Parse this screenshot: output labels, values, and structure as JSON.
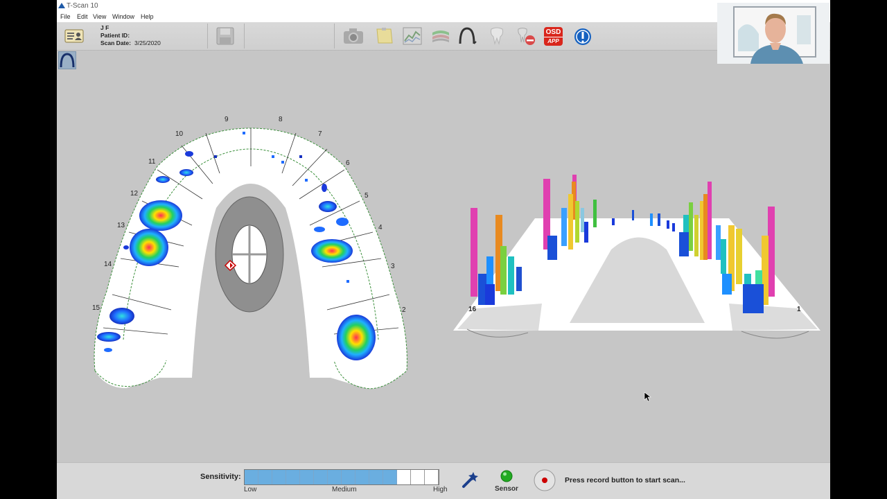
{
  "window": {
    "title": "T-Scan 10"
  },
  "menu": [
    "File",
    "Edit",
    "View",
    "Window",
    "Help"
  ],
  "patient": {
    "name": "J F",
    "id_label": "Patient ID:",
    "id_value": "",
    "scan_date_label": "Scan Date:",
    "scan_date": "3/25/2020"
  },
  "toolbar_icons": [
    "patient-card-icon",
    "save-icon",
    "camera-icon",
    "note-icon",
    "graph-icon",
    "tools-icon",
    "arch-icon",
    "tooth-icon",
    "tooth-remove-icon",
    "osd-app-icon",
    "info-icon"
  ],
  "osd_app": {
    "top": "OSD",
    "bottom": "APP"
  },
  "tooth_numbers_2d": [
    "2",
    "3",
    "4",
    "5",
    "6",
    "7",
    "8",
    "9",
    "10",
    "11",
    "12",
    "13",
    "14",
    "15"
  ],
  "tooth_numbers_3d": [
    "16",
    "1"
  ],
  "bottom": {
    "sensitivity_label": "Sensitivity:",
    "sensitivity_level": 11,
    "sensitivity_total": 14,
    "low": "Low",
    "medium": "Medium",
    "high": "High",
    "sensor_label": "Sensor",
    "status_text": "Press record button to start scan..."
  },
  "colors": {
    "sensitivity_fill": "#6aaee0",
    "sensor_status": "#22aa22",
    "record": "#cc0000",
    "osd": "#d9261c"
  }
}
